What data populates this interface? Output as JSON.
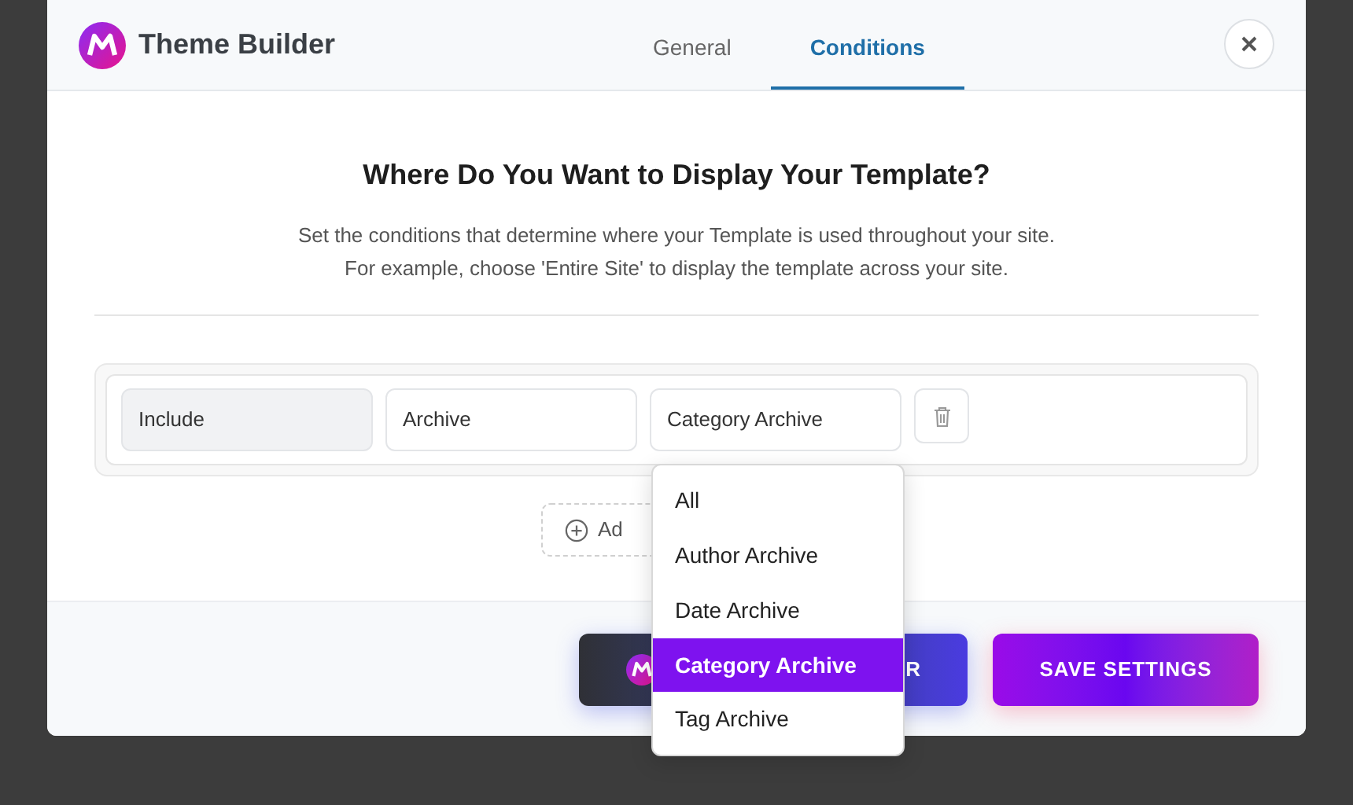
{
  "window": {
    "title": "Theme Builder"
  },
  "tabs": [
    {
      "label": "General",
      "selected": false
    },
    {
      "label": "Conditions",
      "selected": true
    }
  ],
  "heading": "Where Do You Want to Display Your Template?",
  "description": [
    "Set the conditions that determine where your Template is used throughout your site.",
    "For example, choose 'Entire Site' to display the template across your site."
  ],
  "condition": {
    "include": "Include",
    "type": "Archive",
    "subtype": "Category Archive"
  },
  "add_button": {
    "label": "Ad"
  },
  "dropdown": {
    "options": [
      {
        "label": "All",
        "selected": false
      },
      {
        "label": "Author Archive",
        "selected": false
      },
      {
        "label": "Date Archive",
        "selected": false
      },
      {
        "label": "Category Archive",
        "selected": true
      },
      {
        "label": "Tag Archive",
        "selected": false
      }
    ]
  },
  "footer": {
    "editor_button": {
      "label": "R"
    },
    "save_button": {
      "label": "SAVE SETTINGS"
    }
  }
}
